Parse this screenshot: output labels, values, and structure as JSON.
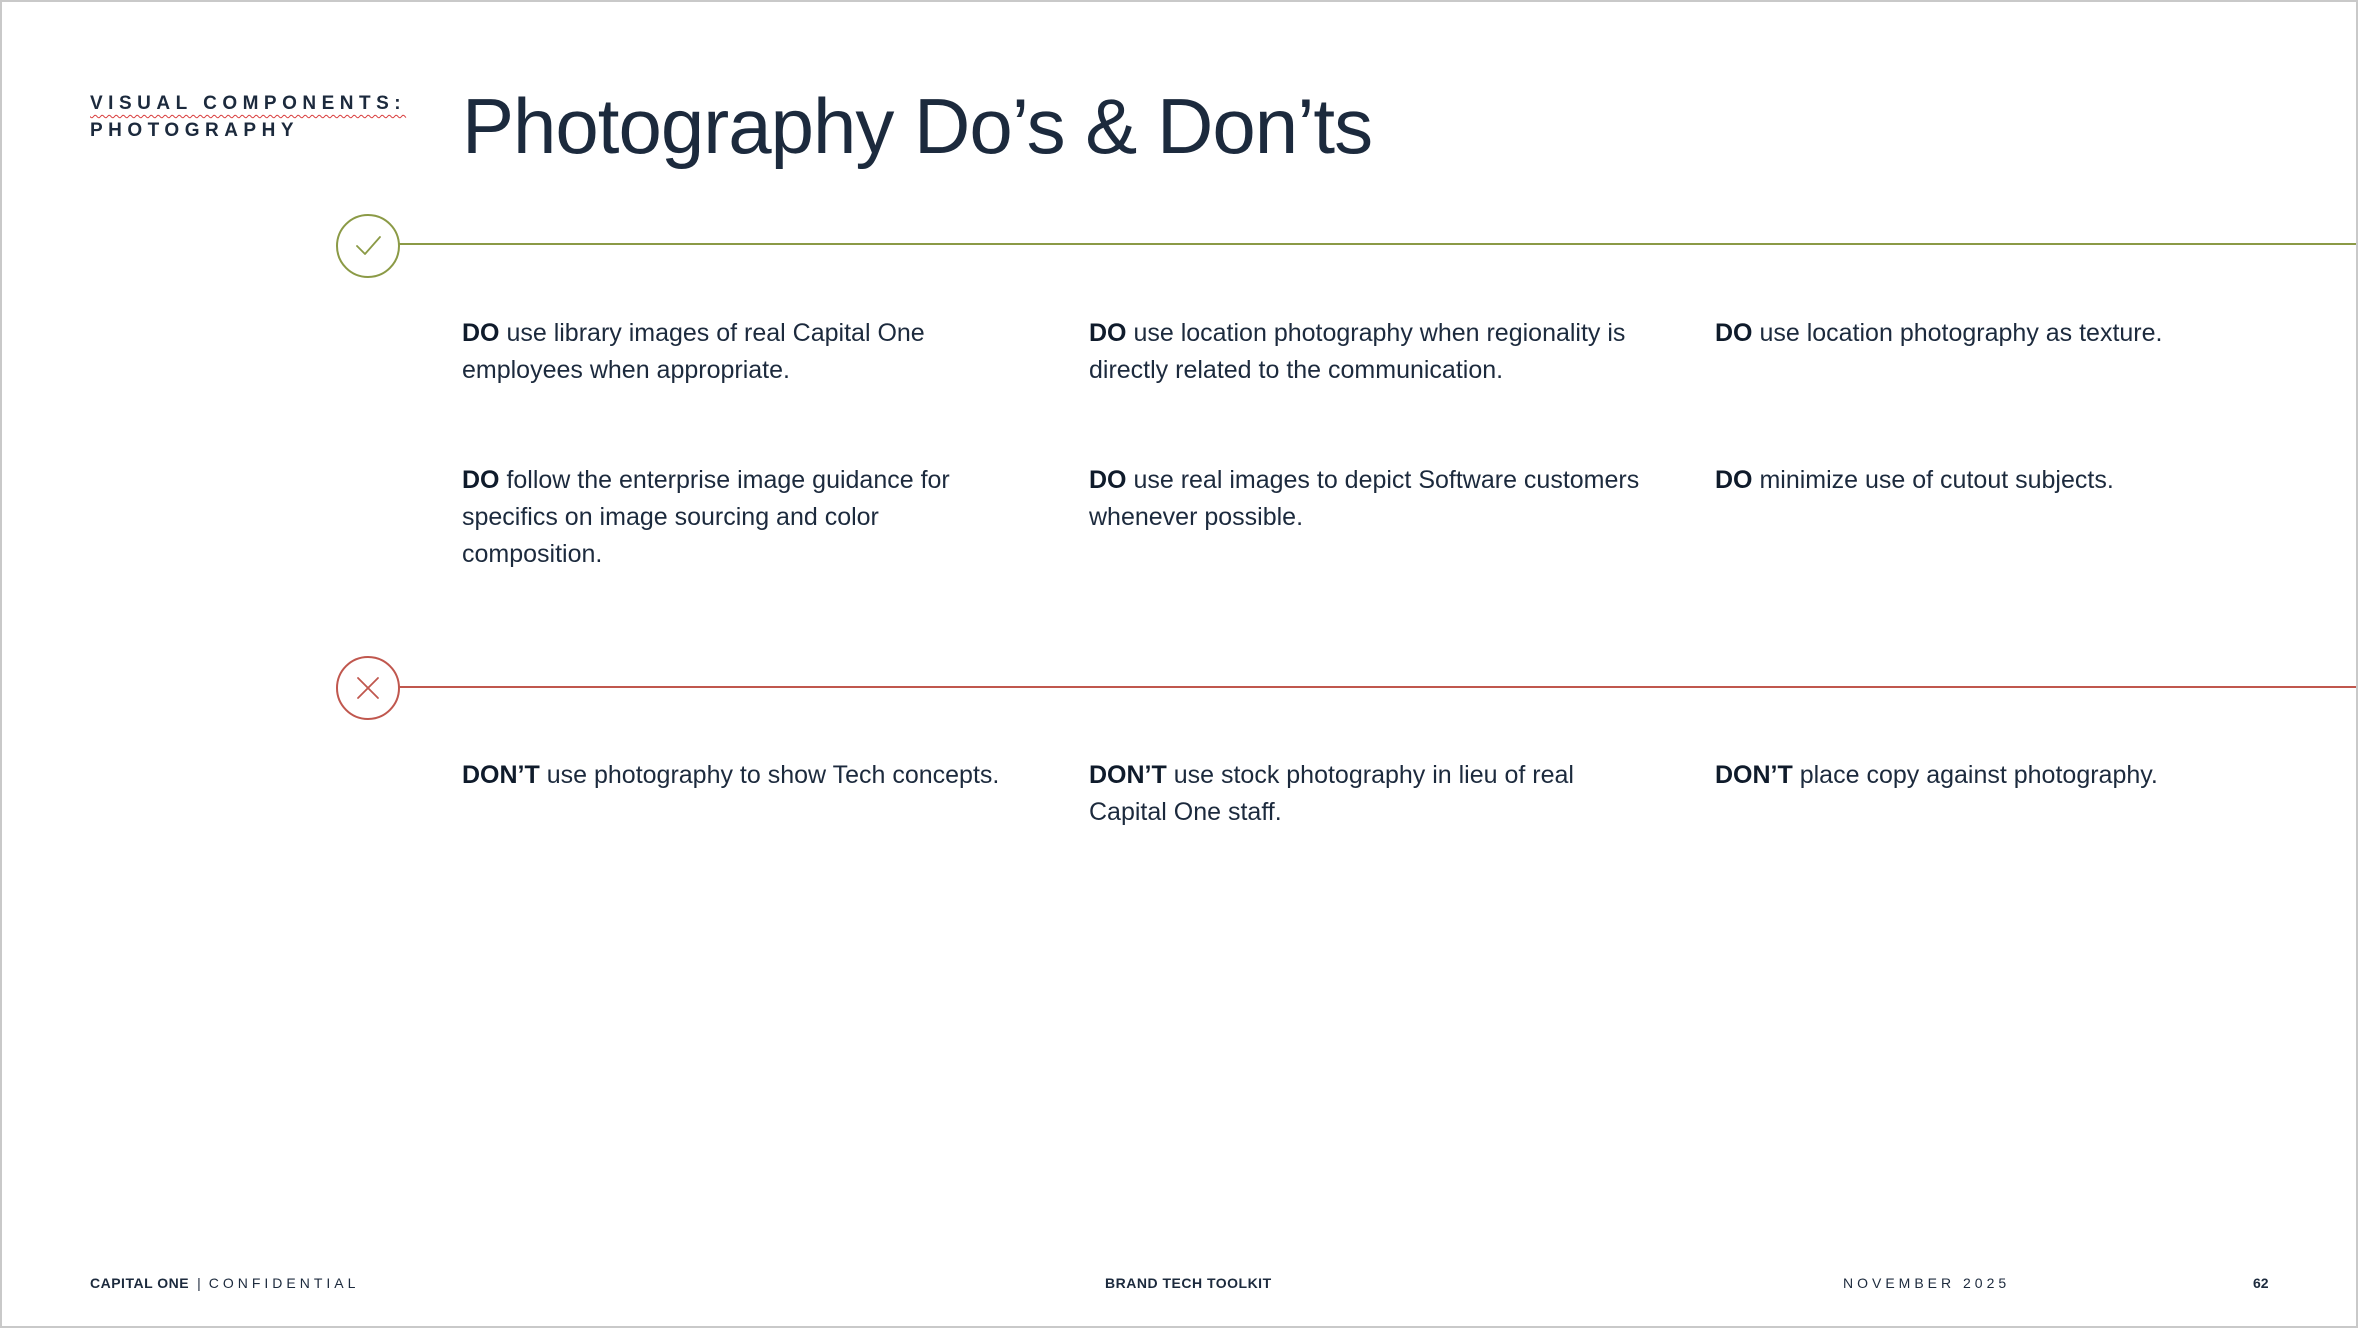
{
  "header": {
    "section_line1": "VISUAL COMPONENTS:",
    "section_line2": "PHOTOGRAPHY",
    "title": "Photography Do’s & Don’ts"
  },
  "colors": {
    "do_accent": "#8b9a46",
    "dont_accent": "#c0574e",
    "text": "#1c2a3d"
  },
  "do_section": {
    "icon": "checkmark-icon",
    "items": [
      {
        "keyword": "DO",
        "text": " use library images of real Capital One employees when appropriate."
      },
      {
        "keyword": "DO",
        "text": " use location photography when regionality is directly related to the communication."
      },
      {
        "keyword": "DO",
        "text": " use location photography as texture."
      },
      {
        "keyword": "DO",
        "text": " follow the enterprise image guidance for specifics on image sourcing and color composition."
      },
      {
        "keyword": "DO",
        "text": " use real images to depict Software customers whenever possible."
      },
      {
        "keyword": "DO",
        "text": " minimize use of cutout subjects."
      }
    ]
  },
  "dont_section": {
    "icon": "x-mark-icon",
    "items": [
      {
        "keyword": "DON’T",
        "text": " use photography to show Tech concepts."
      },
      {
        "keyword": "DON’T",
        "text": " use stock photography in lieu of real Capital One staff."
      },
      {
        "keyword": "DON’T",
        "text": " place copy against photography."
      }
    ]
  },
  "footer": {
    "brand": "CAPITAL ONE",
    "separator": "|",
    "confidential": "CONFIDENTIAL",
    "center": "BRAND TECH TOOLKIT",
    "date": "NOVEMBER 2025",
    "page_number": "62"
  }
}
